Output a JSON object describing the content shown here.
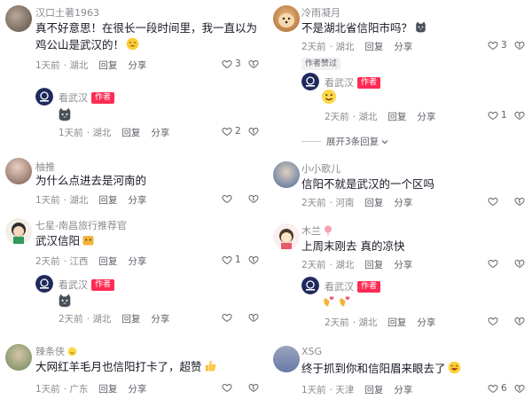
{
  "left": {
    "c1": {
      "username": "汉口土著1963",
      "text": "真不好意思！在很长一段时间里，我一直以为鸡公山是武汉的！",
      "time": "1天前",
      "location": "湖北",
      "reply": "回复",
      "share": "分享",
      "likes": "3",
      "author_reply": {
        "username": "看武汉",
        "badge": "作者",
        "time": "1天前",
        "location": "湖北",
        "reply": "回复",
        "share": "分享",
        "likes": "2"
      }
    },
    "c2": {
      "username": "柚推",
      "text": "为什么点进去是河南的",
      "time": "1天前",
      "location": "湖北",
      "reply": "回复",
      "share": "分享"
    },
    "c3": {
      "username": "七星-南昌旅行推荐官",
      "text": "武汉信阳",
      "time": "2天前",
      "location": "江西",
      "reply": "回复",
      "share": "分享",
      "likes": "1",
      "author_reply": {
        "username": "看武汉",
        "badge": "作者",
        "time": "2天前",
        "location": "湖北",
        "reply": "回复",
        "share": "分享"
      }
    },
    "c4": {
      "username": "辣条侠",
      "text": "大网红羊毛月也信阳打卡了，超赞",
      "time": "1天前",
      "location": "广东",
      "reply": "回复",
      "share": "分享"
    }
  },
  "right": {
    "c1": {
      "username": "冷雨凝月",
      "text": "不是湖北省信阳市吗？",
      "time": "2天前",
      "location": "湖北",
      "reply": "回复",
      "share": "分享",
      "likes": "3",
      "liked_tag": "作者赞过",
      "author_reply": {
        "username": "看武汉",
        "badge": "作者",
        "time": "2天前",
        "location": "湖北",
        "reply": "回复",
        "share": "分享",
        "likes": "1"
      },
      "expand": "展开3条回复"
    },
    "c2": {
      "username": "小小歌儿",
      "text": "信阳不就是武汉的一个区吗",
      "time": "2天前",
      "location": "河南",
      "reply": "回复",
      "share": "分享"
    },
    "c3": {
      "username": "木兰",
      "text": "上周末刚去 真的凉快",
      "time": "2天前",
      "location": "湖北",
      "reply": "回复",
      "share": "分享",
      "author_reply": {
        "username": "看武汉",
        "badge": "作者",
        "time": "2天前",
        "location": "湖北",
        "reply": "回复",
        "share": "分享"
      }
    },
    "c4": {
      "username": "XSG",
      "text": "终于抓到你和信阳眉来眼去了",
      "time": "1天前",
      "location": "天津",
      "reply": "回复",
      "share": "分享",
      "likes": "6"
    }
  },
  "colors": {
    "accent": "#fe2c55",
    "muted": "#8a8b91"
  }
}
